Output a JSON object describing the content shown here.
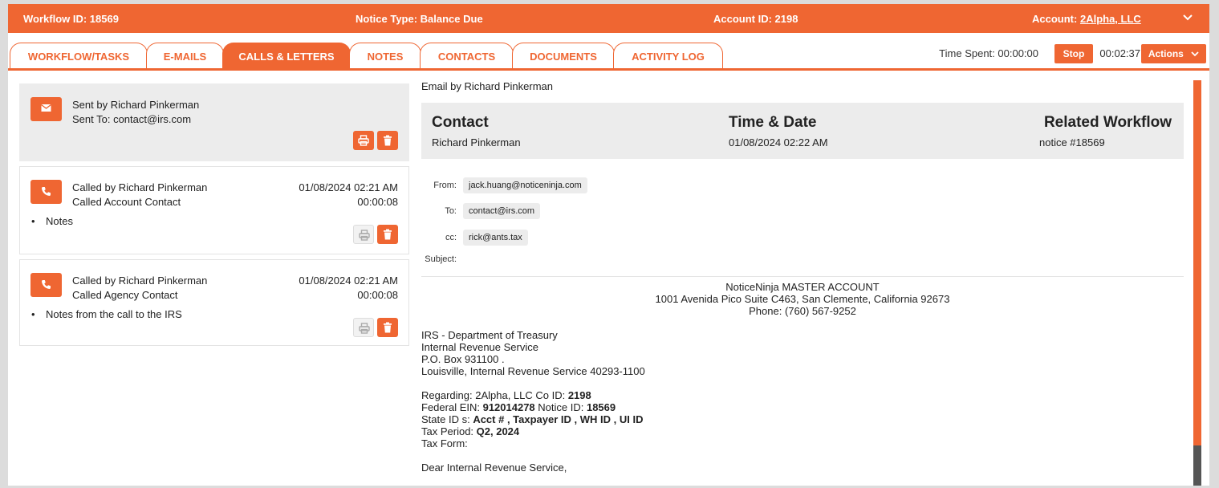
{
  "topbar": {
    "workflow_id": "Workflow ID: 18569",
    "notice_type": "Notice Type: Balance Due",
    "account_id": "Account ID: 2198",
    "account_label": "Account:",
    "account_name": "2Alpha, LLC"
  },
  "tabs": [
    {
      "label": "WORKFLOW/TASKS"
    },
    {
      "label": "E-MAILS"
    },
    {
      "label": "CALLS & LETTERS"
    },
    {
      "label": "NOTES"
    },
    {
      "label": "CONTACTS"
    },
    {
      "label": "DOCUMENTS"
    },
    {
      "label": "ACTIVITY LOG"
    }
  ],
  "timer": {
    "time_spent": "Time Spent: 00:00:00",
    "stop_label": "Stop",
    "elapsed": "00:02:37",
    "actions_label": "Actions"
  },
  "items": {
    "email": {
      "sent_by": "Sent by Richard Pinkerman",
      "sent_to": "Sent To: contact@irs.com"
    },
    "call1": {
      "called_by": "Called by Richard Pinkerman",
      "called_who": "Called Account Contact",
      "datetime": "01/08/2024 02:21 AM",
      "duration": "00:00:08",
      "note": "Notes"
    },
    "call2": {
      "called_by": "Called by Richard Pinkerman",
      "called_who": "Called Agency Contact",
      "datetime": "01/08/2024 02:21 AM",
      "duration": "00:00:08",
      "note": "Notes from the call to the IRS"
    }
  },
  "detail": {
    "email_by": "Email by Richard Pinkerman",
    "contact_heading": "Contact",
    "contact_value": "Richard Pinkerman",
    "time_heading": "Time & Date",
    "time_value": "01/08/2024 02:22 AM",
    "related_heading": "Related Workflow",
    "related_value": "notice #18569",
    "from_label": "From:",
    "from_value": "jack.huang@noticeninja.com",
    "to_label": "To:",
    "to_value": "contact@irs.com",
    "cc_label": "cc:",
    "cc_value": "rick@ants.tax",
    "subject_label": "Subject:"
  },
  "letter": {
    "sender_name": "NoticeNinja MASTER ACCOUNT",
    "sender_address": "1001 Avenida Pico Suite C463, San Clemente, California 92673",
    "sender_phone": "Phone: (760) 567-9252",
    "recipient_1": "IRS - Department of Treasury",
    "recipient_2": "Internal Revenue Service",
    "recipient_3": "P.O. Box 931100 .",
    "recipient_4": "Louisville, Internal Revenue Service 40293-1100",
    "regarding_label": "Regarding: 2Alpha, LLC Co ID: ",
    "regarding_co_id": "2198",
    "ein_label": "Federal EIN: ",
    "ein_value": "912014278",
    "notice_label": " Notice ID: ",
    "notice_value": "18569",
    "state_label": "State ID s: ",
    "state_value": "Acct # , Taxpayer ID , WH ID , UI ID",
    "period_label": "Tax Period: ",
    "period_value": "Q2, 2024",
    "form_label": "Tax Form:",
    "salutation": "Dear Internal Revenue Service,"
  },
  "colors": {
    "accent": "#ef6632",
    "panel": "#ececec"
  },
  "icons": [
    "chevron-down-icon",
    "envelope-icon",
    "phone-icon",
    "print-icon",
    "trash-icon"
  ]
}
